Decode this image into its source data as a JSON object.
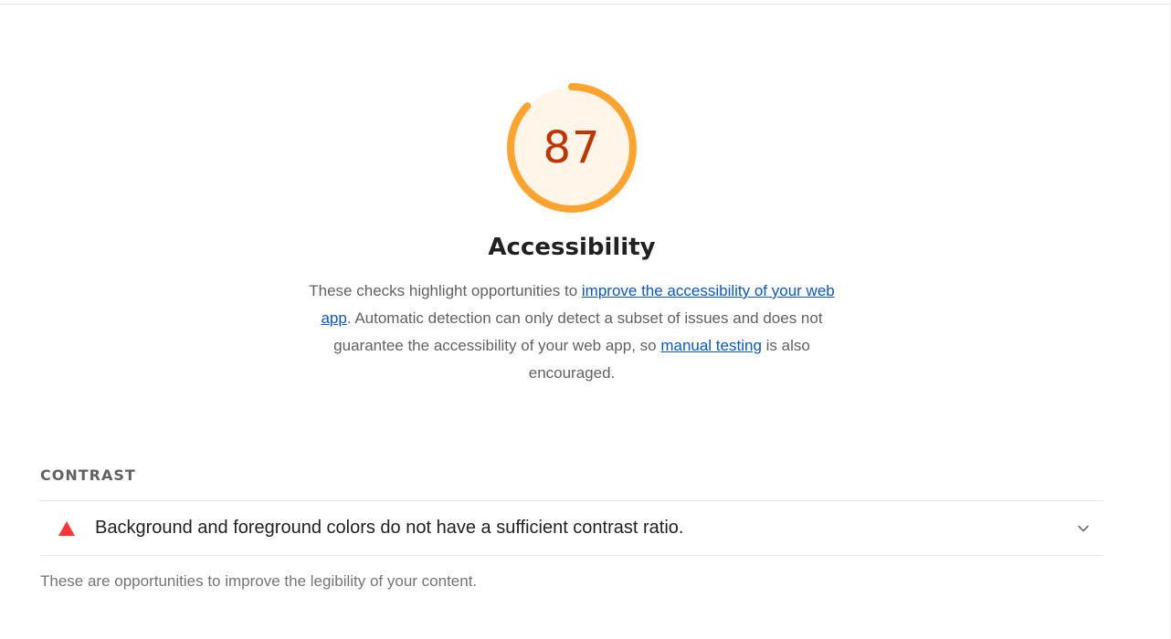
{
  "category": {
    "score": "87",
    "score_fraction": 0.87,
    "title": "Accessibility",
    "description": {
      "text_before": "These checks highlight opportunities to ",
      "link1": "improve the accessibility of your web app",
      "text_middle": ". Automatic detection can only detect a subset of issues and does not guarantee the accessibility of your web app, so ",
      "link2": "manual testing",
      "text_after": " is also encouraged."
    }
  },
  "group": {
    "title": "CONTRAST",
    "audits": [
      {
        "title": "Background and foreground colors do not have a sufficient contrast ratio.",
        "status": "fail",
        "icon": "fail-triangle-icon"
      }
    ],
    "description": "These are opportunities to improve the legibility of your content."
  },
  "colors": {
    "gauge_arc": "#ffa32f",
    "gauge_fill": "#fff5e8",
    "score_text": "#c33300",
    "link": "#0b57d0",
    "fail": "#ff3333"
  }
}
